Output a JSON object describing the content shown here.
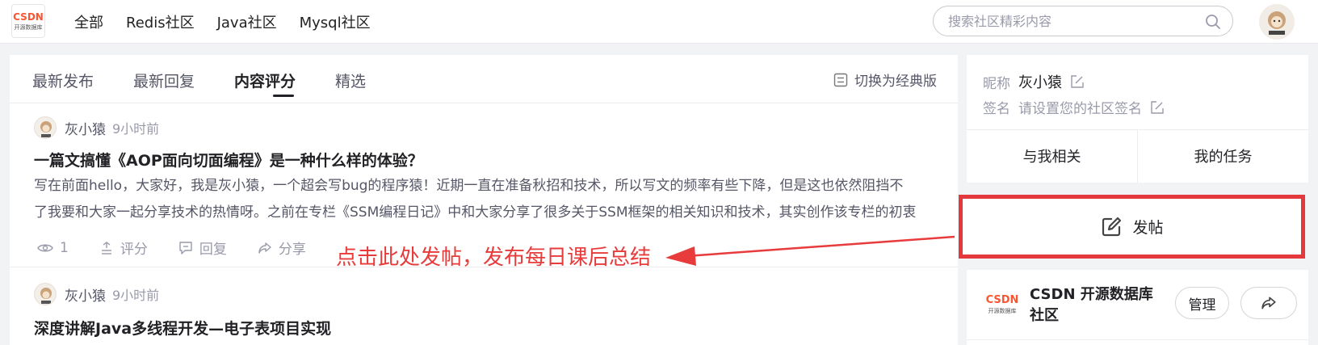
{
  "header": {
    "logo_text": "CSDN",
    "logo_sub": "开源数据库",
    "nav": [
      "全部",
      "Redis社区",
      "Java社区",
      "Mysql社区"
    ],
    "search_placeholder": "搜索社区精彩内容"
  },
  "tabs": {
    "items": [
      "最新发布",
      "最新回复",
      "内容评分",
      "精选"
    ],
    "active": "内容评分",
    "switch_label": "切换为经典版"
  },
  "posts": [
    {
      "author": "灰小猿",
      "time": "9小时前",
      "title": "一篇文搞懂《AOP面向切面编程》是一种什么样的体验？",
      "excerpt_line1": "写在前面hello，大家好，我是灰小猿，一个超会写bug的程序猿！近期一直在准备秋招和技术，所以写文的频率有些下降，但是这也依然阻挡不",
      "excerpt_line2": "了我要和大家一起分享技术的热情呀。之前在专栏《SSM编程日记》中和大家分享了很多关于SSM框架的相关知识和技术，其实创作该专栏的初衷",
      "views": "1",
      "rate_label": "评分",
      "reply_label": "回复",
      "share_label": "分享"
    },
    {
      "author": "灰小猿",
      "time": "9小时前",
      "title": "深度讲解Java多线程开发—电子表项目实现"
    }
  ],
  "annotation": {
    "text": "点击此处发帖，发布每日课后总结",
    "color": "#e83b3b"
  },
  "sidebar": {
    "nickname_label": "昵称",
    "nickname_value": "灰小猿",
    "signature_label": "签名",
    "signature_placeholder": "请设置您的社区签名",
    "related_label": "与我相关",
    "tasks_label": "我的任务",
    "post_label": "发帖",
    "community": {
      "logo_text": "CSDN",
      "logo_sub": "开源数据库",
      "name": "CSDN 开源数据库社区",
      "manage_label": "管理"
    }
  },
  "colors": {
    "accent_red": "#e4393c",
    "brand": "#fc5531"
  }
}
